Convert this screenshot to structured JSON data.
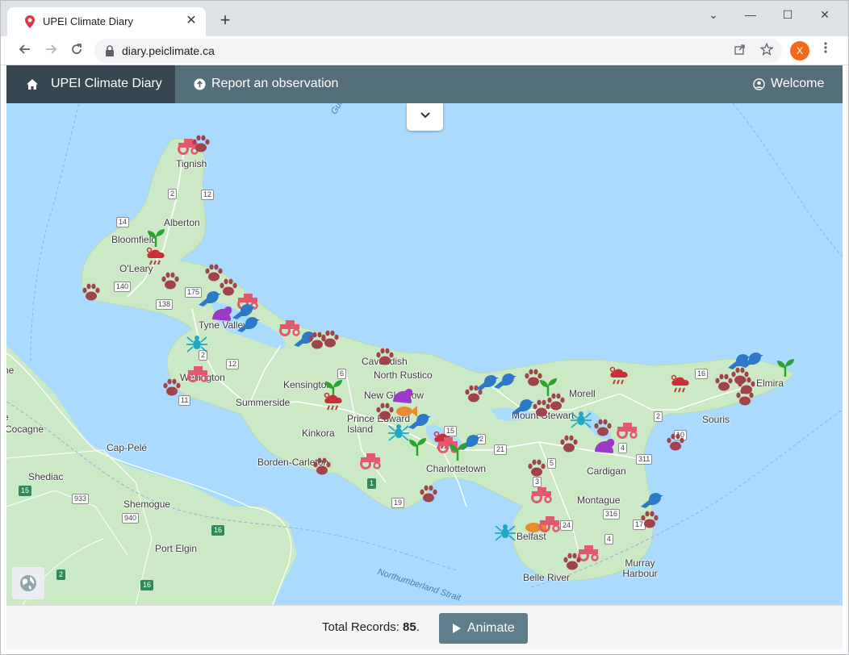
{
  "browser": {
    "tab_title": "UPEI Climate Diary",
    "close_glyph": "✕",
    "new_tab_glyph": "+",
    "url": "diary.peiclimate.ca",
    "profile_initial": "X",
    "window_controls": {
      "chevron": "⌄",
      "minimize": "—",
      "maximize": "☐",
      "close": "✕"
    }
  },
  "nav": {
    "brand": "UPEI Climate Diary",
    "report": "Report an observation",
    "welcome": "Welcome"
  },
  "map": {
    "water_labels": {
      "gulf": "Gulf of St L...",
      "strait": "Northumberland Strait"
    },
    "places": {
      "tignish": "Tignish",
      "alberton": "Alberton",
      "bloomfield": "Bloomfield",
      "oleary": "O'Leary",
      "tyne_valley": "Tyne Valley",
      "wellington": "Wellington",
      "summerside": "Summerside",
      "kensington": "Kensington",
      "cavendish": "Cavendish",
      "north_rustico": "North Rustico",
      "new_glasgow": "New Glasgow",
      "prince_edward_island": "Prince Edward Island",
      "kinkora": "Kinkora",
      "borden_carleton": "Borden-Carleton",
      "charlottetown": "Charlottetown",
      "mount_stewart": "Mount Stewart",
      "morell": "Morell",
      "souris": "Souris",
      "elmira": "Elmira",
      "cardigan": "Cardigan",
      "montague": "Montague",
      "belfast": "Belfast",
      "murray_harbour": "Murray Harbour",
      "belle_river": "Belle River",
      "cocagne": "Cocagne",
      "cap_pele": "Cap-Pelé",
      "shediac": "Shediac",
      "shemogue": "Shemogue",
      "port_elgin": "Port Elgin",
      "ne": "ne",
      "ie": "e"
    },
    "routes": {
      "r2a": "2",
      "r12a": "12",
      "r14": "14",
      "r140": "140",
      "r175": "175",
      "r138": "138",
      "r2b": "2",
      "r12b": "12",
      "r11": "11",
      "r6": "6",
      "r1": "1",
      "r2c": "2",
      "r21": "21",
      "r15": "15",
      "r19": "19",
      "r16a": "16",
      "r2d": "2",
      "r10": "10",
      "r4a": "4",
      "r311": "311",
      "r5": "5",
      "r3": "3",
      "r24": "24",
      "r316": "316",
      "r17": "17",
      "r4b": "4",
      "r15b": "15",
      "r933": "933",
      "r940": "940",
      "r16b": "16",
      "r16c": "16",
      "r2e": "2"
    }
  },
  "footer": {
    "records_label": "Total Records:",
    "records_count": "85",
    "records_suffix": ".",
    "animate_label": "Animate"
  },
  "colors": {
    "nav_bar": "#546e7a",
    "nav_brand": "#37474f",
    "water": "#aadaff",
    "land": "#cbe9c5",
    "paw": "#a0434b",
    "bird": "#2d79c7",
    "tractor": "#e05a6e",
    "plant": "#2aa52a",
    "frog": "#9b39c9",
    "spider": "#1fa8c4",
    "fish": "#e88a2e",
    "storm": "#c92f3a",
    "button": "#607d8b"
  }
}
